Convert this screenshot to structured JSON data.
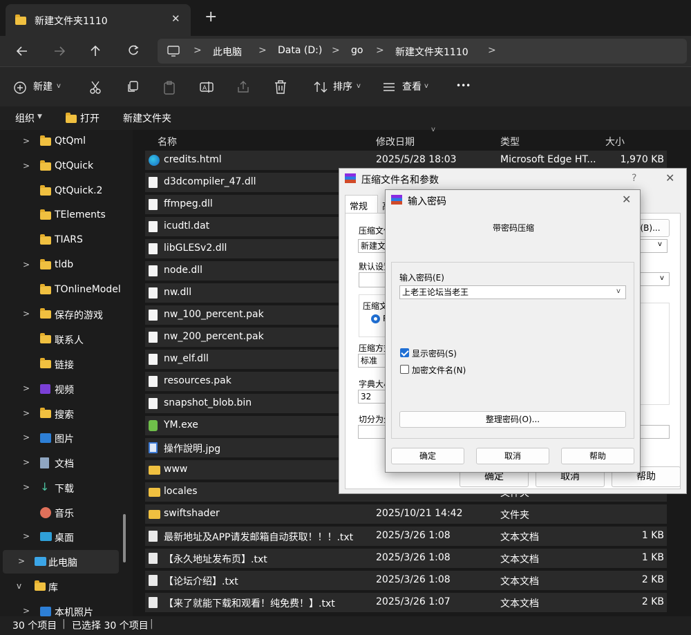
{
  "tab": {
    "title": "新建文件夹1110",
    "close": "✕",
    "add": "+"
  },
  "breadcrumb": [
    "此电脑",
    "Data (D:)",
    "go",
    "新建文件夹1110"
  ],
  "toolbar": {
    "new": "新建",
    "sort": "排序",
    "view": "查看",
    "more": "•••"
  },
  "cmdbar": {
    "organize": "组织",
    "open": "打开",
    "newfolder": "新建文件夹"
  },
  "sidebar": [
    {
      "label": "QtQml",
      "chev": ">",
      "icon": "folder-icon"
    },
    {
      "label": "QtQuick",
      "chev": ">",
      "icon": "folder-icon"
    },
    {
      "label": "QtQuick.2",
      "chev": "",
      "icon": "folder-icon"
    },
    {
      "label": "TElements",
      "chev": "",
      "icon": "folder-icon"
    },
    {
      "label": "TIARS",
      "chev": "",
      "icon": "folder-icon"
    },
    {
      "label": "tldb",
      "chev": ">",
      "icon": "folder-icon"
    },
    {
      "label": "TOnlineModel",
      "chev": "",
      "icon": "folder-icon"
    },
    {
      "label": "保存的游戏",
      "chev": ">",
      "icon": "folder-icon"
    },
    {
      "label": "联系人",
      "chev": "",
      "icon": "folder-icon"
    },
    {
      "label": "链接",
      "chev": "",
      "icon": "folder-icon"
    },
    {
      "label": "视频",
      "chev": ">",
      "icon": "video-icon"
    },
    {
      "label": "搜索",
      "chev": ">",
      "icon": "folder-icon"
    },
    {
      "label": "图片",
      "chev": ">",
      "icon": "picture-icon"
    },
    {
      "label": "文档",
      "chev": ">",
      "icon": "document-icon"
    },
    {
      "label": "下载",
      "chev": ">",
      "icon": "download-icon"
    },
    {
      "label": "音乐",
      "chev": "",
      "icon": "music-icon"
    },
    {
      "label": "桌面",
      "chev": ">",
      "icon": "desktop-icon"
    },
    {
      "label": "此电脑",
      "chev": ">",
      "icon": "pc-icon"
    },
    {
      "label": "库",
      "chev": "v",
      "icon": "folder-icon"
    },
    {
      "label": "本机照片",
      "chev": ">",
      "icon": "picture-icon"
    }
  ],
  "columns": {
    "name": "名称",
    "date": "修改日期",
    "type": "类型",
    "size": "大小"
  },
  "files": [
    {
      "name": "credits.html",
      "date": "2025/5/28 18:03",
      "type": "Microsoft Edge HT...",
      "size": "1,970 KB",
      "icon": "edge-icon"
    },
    {
      "name": "d3dcompiler_47.dll",
      "date": "",
      "type": "",
      "size": "",
      "icon": "dll-icon"
    },
    {
      "name": "ffmpeg.dll",
      "date": "",
      "type": "",
      "size": "",
      "icon": "dll-icon"
    },
    {
      "name": "icudtl.dat",
      "date": "",
      "type": "",
      "size": "",
      "icon": "file-icon"
    },
    {
      "name": "libGLESv2.dll",
      "date": "",
      "type": "",
      "size": "",
      "icon": "dll-icon"
    },
    {
      "name": "node.dll",
      "date": "",
      "type": "",
      "size": "",
      "icon": "dll-icon"
    },
    {
      "name": "nw.dll",
      "date": "",
      "type": "",
      "size": "",
      "icon": "dll-icon"
    },
    {
      "name": "nw_100_percent.pak",
      "date": "",
      "type": "",
      "size": "",
      "icon": "file-icon"
    },
    {
      "name": "nw_200_percent.pak",
      "date": "",
      "type": "",
      "size": "",
      "icon": "file-icon"
    },
    {
      "name": "nw_elf.dll",
      "date": "",
      "type": "",
      "size": "",
      "icon": "dll-icon"
    },
    {
      "name": "resources.pak",
      "date": "",
      "type": "",
      "size": "",
      "icon": "file-icon"
    },
    {
      "name": "snapshot_blob.bin",
      "date": "",
      "type": "",
      "size": "",
      "icon": "file-icon"
    },
    {
      "name": "YM.exe",
      "date": "",
      "type": "",
      "size": "",
      "icon": "exe-icon"
    },
    {
      "name": "操作說明.jpg",
      "date": "",
      "type": "",
      "size": "",
      "icon": "image-icon"
    },
    {
      "name": "www",
      "date": "",
      "type": "",
      "size": "",
      "icon": "folder-icon"
    },
    {
      "name": "locales",
      "date": "",
      "type": "文件夹",
      "size": "",
      "icon": "folder-icon"
    },
    {
      "name": "swiftshader",
      "date": "2025/10/21 14:42",
      "type": "文件夹",
      "size": "",
      "icon": "folder-icon"
    },
    {
      "name": "最新地址及APP请发邮箱自动获取！！！.txt",
      "date": "2025/3/26 1:08",
      "type": "文本文档",
      "size": "1 KB",
      "icon": "text-icon"
    },
    {
      "name": "【永久地址发布页】.txt",
      "date": "2025/3/26 1:08",
      "type": "文本文档",
      "size": "1 KB",
      "icon": "text-icon"
    },
    {
      "name": "【论坛介绍】.txt",
      "date": "2025/3/26 1:08",
      "type": "文本文档",
      "size": "2 KB",
      "icon": "text-icon"
    },
    {
      "name": "【来了就能下载和观看！纯免费！】.txt",
      "date": "2025/3/26 1:07",
      "type": "文本文档",
      "size": "2 KB",
      "icon": "text-icon"
    }
  ],
  "status": {
    "count": "30 个项目",
    "selected": "已选择 30 个项目"
  },
  "archive_dialog": {
    "title": "压缩文件名和参数",
    "help_mark": "?",
    "tab_general": "常规",
    "tab2": "高",
    "label_name": "压缩文件",
    "value_name": "新建文",
    "browse": "(B)...",
    "label_default": "默认设置",
    "label_format": "压缩文",
    "radio": "R",
    "label_method": "压缩方式",
    "value_method": "标准",
    "label_dict": "字典大小",
    "value_dict": "32",
    "label_split": "切分为分",
    "ok": "确定",
    "cancel": "取消",
    "help": "帮助"
  },
  "password_dialog": {
    "title": "输入密码",
    "heading": "带密码压缩",
    "label": "输入密码(E)",
    "value": "上老王论坛当老王",
    "show": "显示密码(S)",
    "encrypt": "加密文件名(N)",
    "organize": "整理密码(O)...",
    "ok": "确定",
    "cancel": "取消",
    "help": "帮助",
    "show_checked": true,
    "encrypt_checked": false
  }
}
